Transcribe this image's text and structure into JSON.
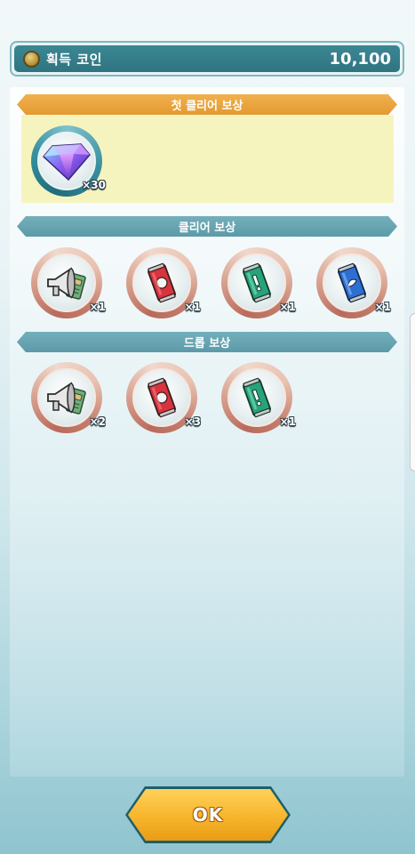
{
  "coin_bar": {
    "label": "획득 코인",
    "value": "10,100",
    "icon": "coin-icon"
  },
  "sections": {
    "first_clear": {
      "title": "첫 클리어 보상",
      "items": [
        {
          "icon": "diamond-icon",
          "qty": "×30"
        }
      ]
    },
    "clear": {
      "title": "클리어 보상",
      "items": [
        {
          "icon": "megaphone-ticket-icon",
          "qty": "×1"
        },
        {
          "icon": "red-can-icon",
          "qty": "×1"
        },
        {
          "icon": "green-can-icon",
          "qty": "×1"
        },
        {
          "icon": "blue-can-icon",
          "qty": "×1"
        }
      ]
    },
    "drop": {
      "title": "드롭 보상",
      "items": [
        {
          "icon": "megaphone-ticket-icon",
          "qty": "×2"
        },
        {
          "icon": "red-can-icon",
          "qty": "×3"
        },
        {
          "icon": "green-can-icon",
          "qty": "×1"
        }
      ]
    }
  },
  "ok_button": {
    "label": "OK"
  },
  "colors": {
    "header_orange": "#e39a31",
    "header_teal": "#5d9aa8",
    "coin_bar": "#2f7480",
    "ok_button": "#f6b52c"
  }
}
